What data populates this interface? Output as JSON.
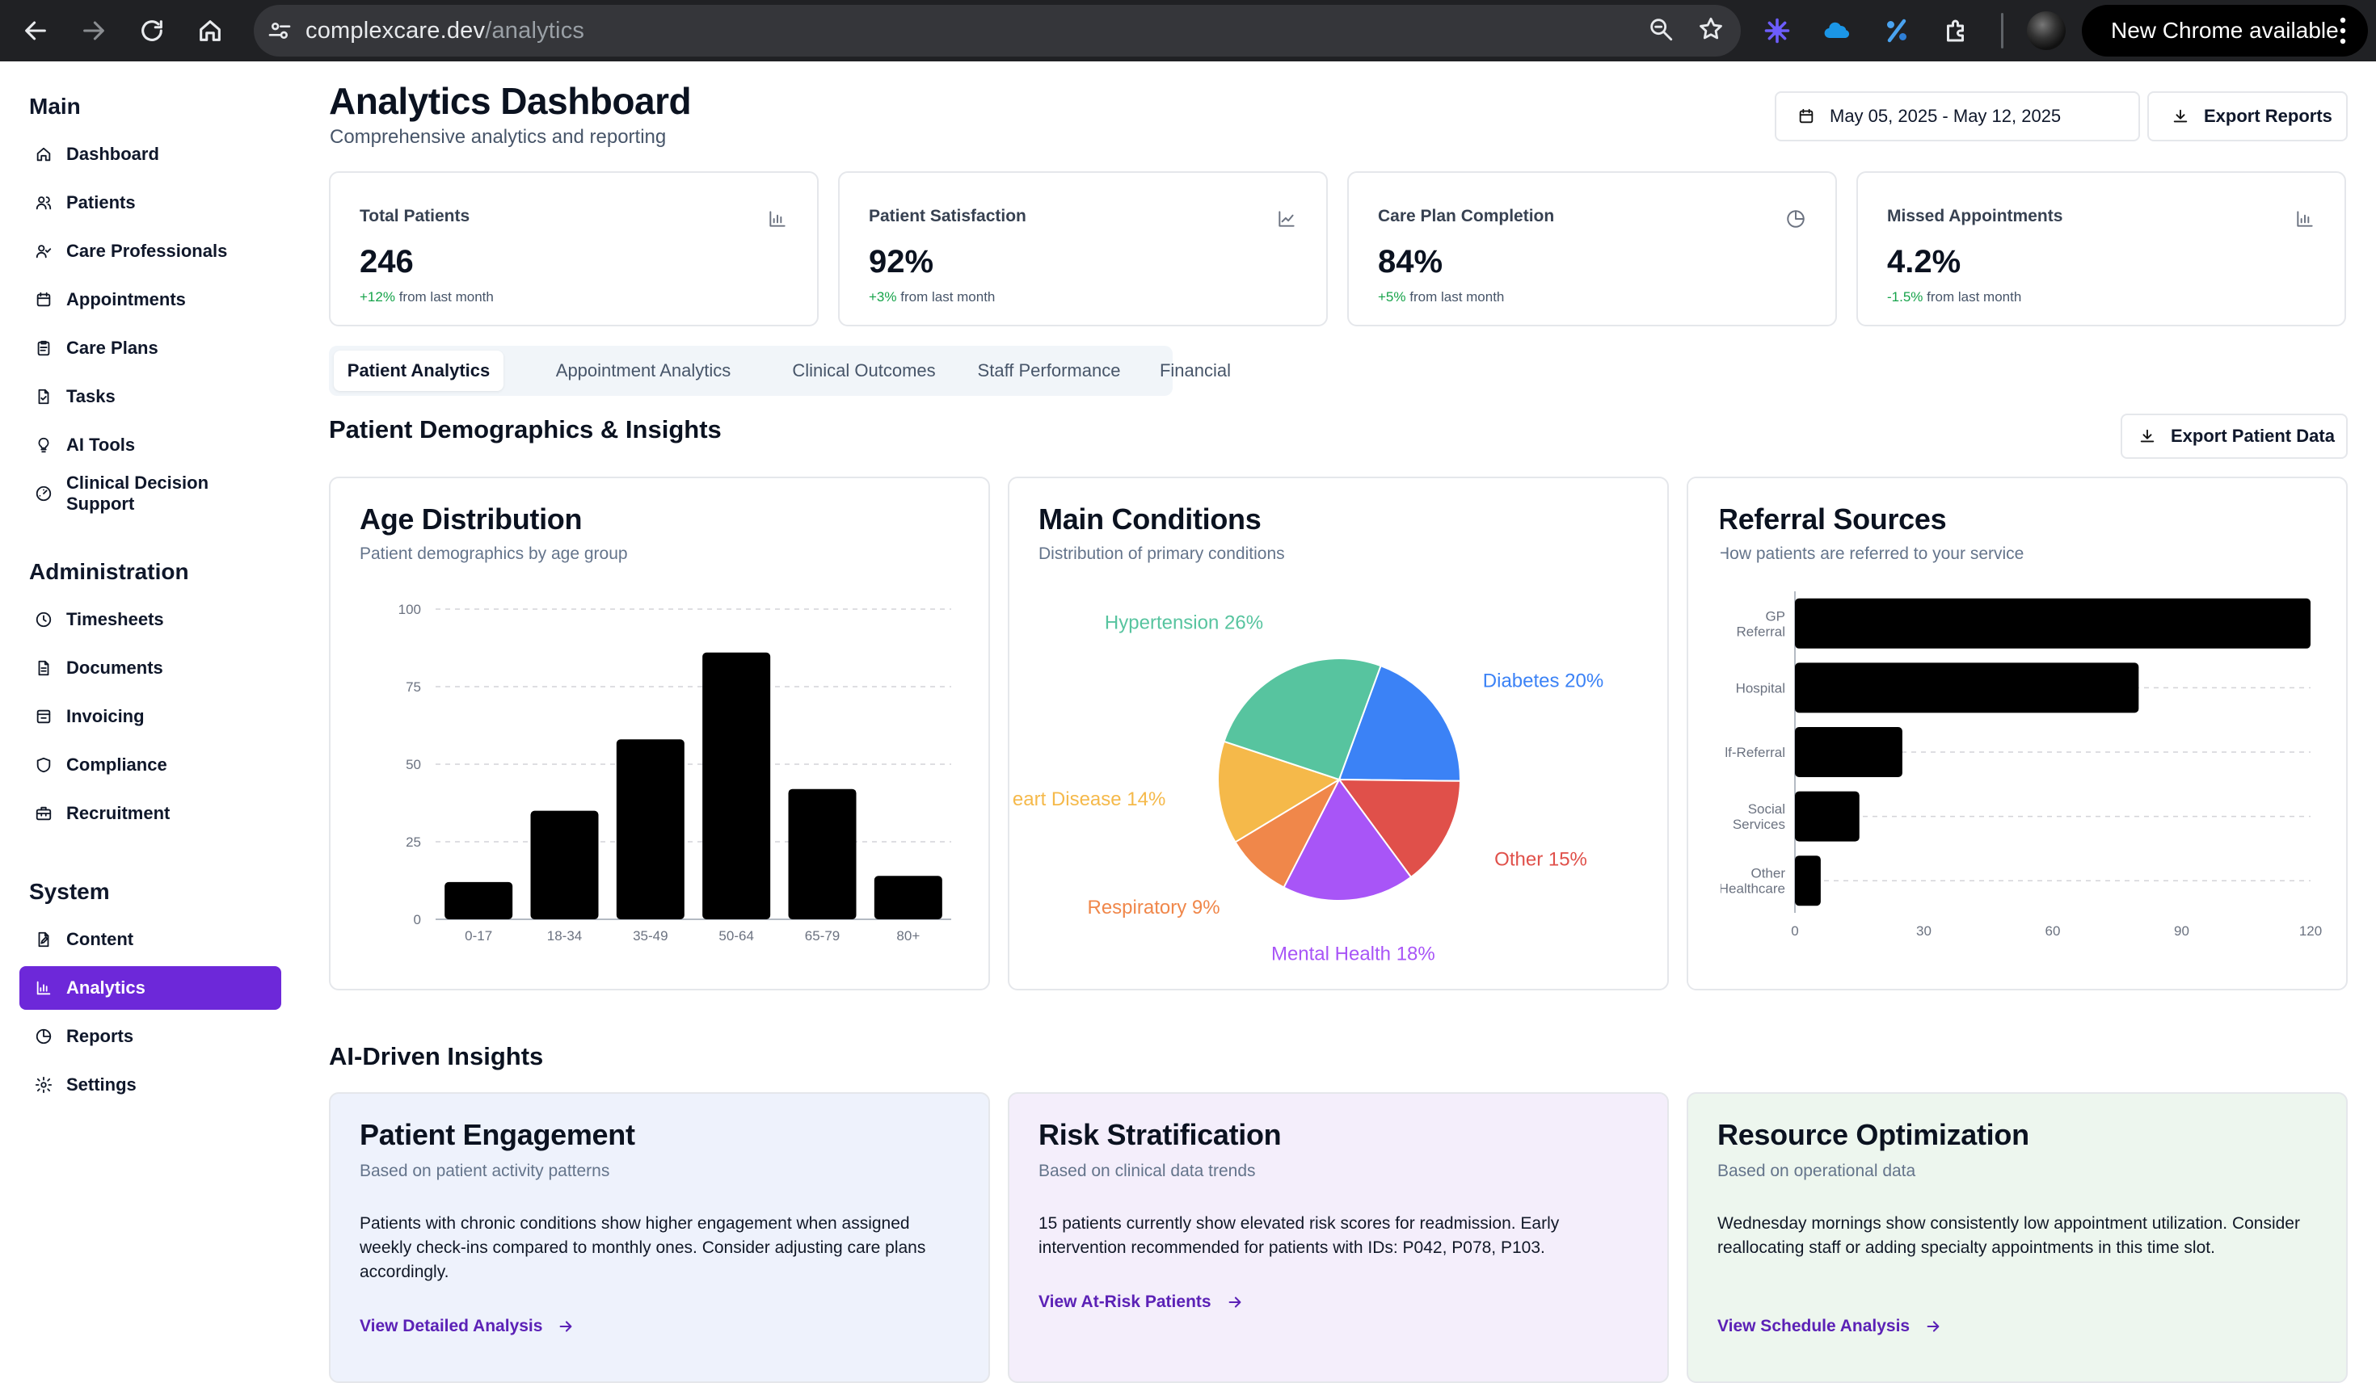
{
  "browser": {
    "url_host": "complexcare.dev",
    "url_path": "/analytics",
    "update_label": "New Chrome available"
  },
  "sidebar": {
    "groups": [
      {
        "title": "Main",
        "items": [
          {
            "label": "Dashboard",
            "icon": "home-icon"
          },
          {
            "label": "Patients",
            "icon": "users-icon"
          },
          {
            "label": "Care Professionals",
            "icon": "user-check-icon"
          },
          {
            "label": "Appointments",
            "icon": "calendar-icon"
          },
          {
            "label": "Care Plans",
            "icon": "clipboard-icon"
          },
          {
            "label": "Tasks",
            "icon": "file-check-icon"
          },
          {
            "label": "AI Tools",
            "icon": "lightbulb-icon"
          },
          {
            "label": "Clinical Decision Support",
            "icon": "gauge-icon"
          }
        ]
      },
      {
        "title": "Administration",
        "items": [
          {
            "label": "Timesheets",
            "icon": "clock-icon"
          },
          {
            "label": "Documents",
            "icon": "document-icon"
          },
          {
            "label": "Invoicing",
            "icon": "invoice-icon"
          },
          {
            "label": "Compliance",
            "icon": "shield-icon"
          },
          {
            "label": "Recruitment",
            "icon": "briefcase-icon"
          }
        ]
      },
      {
        "title": "System",
        "items": [
          {
            "label": "Content",
            "icon": "file-edit-icon"
          },
          {
            "label": "Analytics",
            "icon": "bar-chart-icon",
            "active": true
          },
          {
            "label": "Reports",
            "icon": "pie-chart-icon"
          },
          {
            "label": "Settings",
            "icon": "gear-icon"
          }
        ]
      }
    ]
  },
  "header": {
    "title": "Analytics Dashboard",
    "subtitle": "Comprehensive analytics and reporting",
    "date_range": "May 05, 2025 - May 12, 2025",
    "export_label": "Export Reports"
  },
  "stats": [
    {
      "label": "Total Patients",
      "value": "246",
      "change": "+12%",
      "change_suffix": "from last month",
      "icon": "bar-chart-icon"
    },
    {
      "label": "Patient Satisfaction",
      "value": "92%",
      "change": "+3%",
      "change_suffix": "from last month",
      "icon": "line-chart-icon"
    },
    {
      "label": "Care Plan Completion",
      "value": "84%",
      "change": "+5%",
      "change_suffix": "from last month",
      "icon": "pie-chart-icon"
    },
    {
      "label": "Missed Appointments",
      "value": "4.2%",
      "change": "-1.5%",
      "change_suffix": "from last month",
      "icon": "bar-chart-icon"
    }
  ],
  "tabs": [
    "Patient Analytics",
    "Appointment Analytics",
    "Clinical Outcomes",
    "Staff Performance",
    "Financial"
  ],
  "active_tab": 0,
  "demographics": {
    "title": "Patient Demographics & Insights",
    "export_label": "Export Patient Data"
  },
  "panels": {
    "age": {
      "title": "Age Distribution",
      "subtitle": "Patient demographics by age group"
    },
    "conditions": {
      "title": "Main Conditions",
      "subtitle": "Distribution of primary conditions"
    },
    "referrals": {
      "title": "Referral Sources",
      "subtitle": "How patients are referred to your service"
    }
  },
  "chart_data": [
    {
      "type": "bar",
      "title": "Age Distribution",
      "categories": [
        "0-17",
        "18-34",
        "35-49",
        "50-64",
        "65-79",
        "80+"
      ],
      "values": [
        12,
        35,
        58,
        86,
        42,
        14
      ],
      "ylim": [
        0,
        100
      ],
      "yticks": [
        0,
        25,
        50,
        75,
        100
      ],
      "grid": true,
      "color": "#000000"
    },
    {
      "type": "pie",
      "title": "Main Conditions",
      "slices": [
        {
          "label": "Diabetes",
          "value": 20,
          "display": "Diabetes 20%",
          "color": "#3b82f6"
        },
        {
          "label": "Other",
          "value": 15,
          "display": "Other 15%",
          "color": "#e0504a"
        },
        {
          "label": "Mental Health",
          "value": 18,
          "display": "Mental Health 18%",
          "color": "#a855f7"
        },
        {
          "label": "Respiratory",
          "value": 9,
          "display": "Respiratory 9%",
          "color": "#f0874a"
        },
        {
          "label": "Heart Disease",
          "value": 14,
          "display": "eart Disease 14%",
          "color": "#f5b94a"
        },
        {
          "label": "Hypertension",
          "value": 26,
          "display": "Hypertension 26%",
          "color": "#57c49f"
        }
      ]
    },
    {
      "type": "bar",
      "orientation": "horizontal",
      "title": "Referral Sources",
      "categories": [
        [
          "GP",
          "Referral"
        ],
        [
          "Hospital"
        ],
        [
          "lf-Referral"
        ],
        [
          "Social",
          "Services"
        ],
        [
          "Other",
          "Healthcare"
        ]
      ],
      "values": [
        120,
        80,
        25,
        15,
        6
      ],
      "xlim": [
        0,
        120
      ],
      "xticks": [
        0,
        30,
        60,
        90,
        120
      ],
      "grid": true,
      "color": "#000000"
    }
  ],
  "ai": {
    "title": "AI-Driven Insights",
    "cards": [
      {
        "title": "Patient Engagement",
        "subtitle": "Based on patient activity patterns",
        "body": "Patients with chronic conditions show higher engagement when assigned weekly check-ins compared to monthly ones. Consider adjusting care plans accordingly.",
        "link": "View Detailed Analysis",
        "bg": "#eef2fc"
      },
      {
        "title": "Risk Stratification",
        "subtitle": "Based on clinical data trends",
        "body": "15 patients currently show elevated risk scores for readmission. Early intervention recommended for patients with IDs: P042, P078, P103.",
        "link": "View At-Risk Patients",
        "bg": "#f4eefb"
      },
      {
        "title": "Resource Optimization",
        "subtitle": "Based on operational data",
        "body": "Wednesday mornings show consistently low appointment utilization. Consider reallocating staff or adding specialty appointments in this time slot.",
        "link": "View Schedule Analysis",
        "bg": "#edf6ee"
      }
    ]
  }
}
